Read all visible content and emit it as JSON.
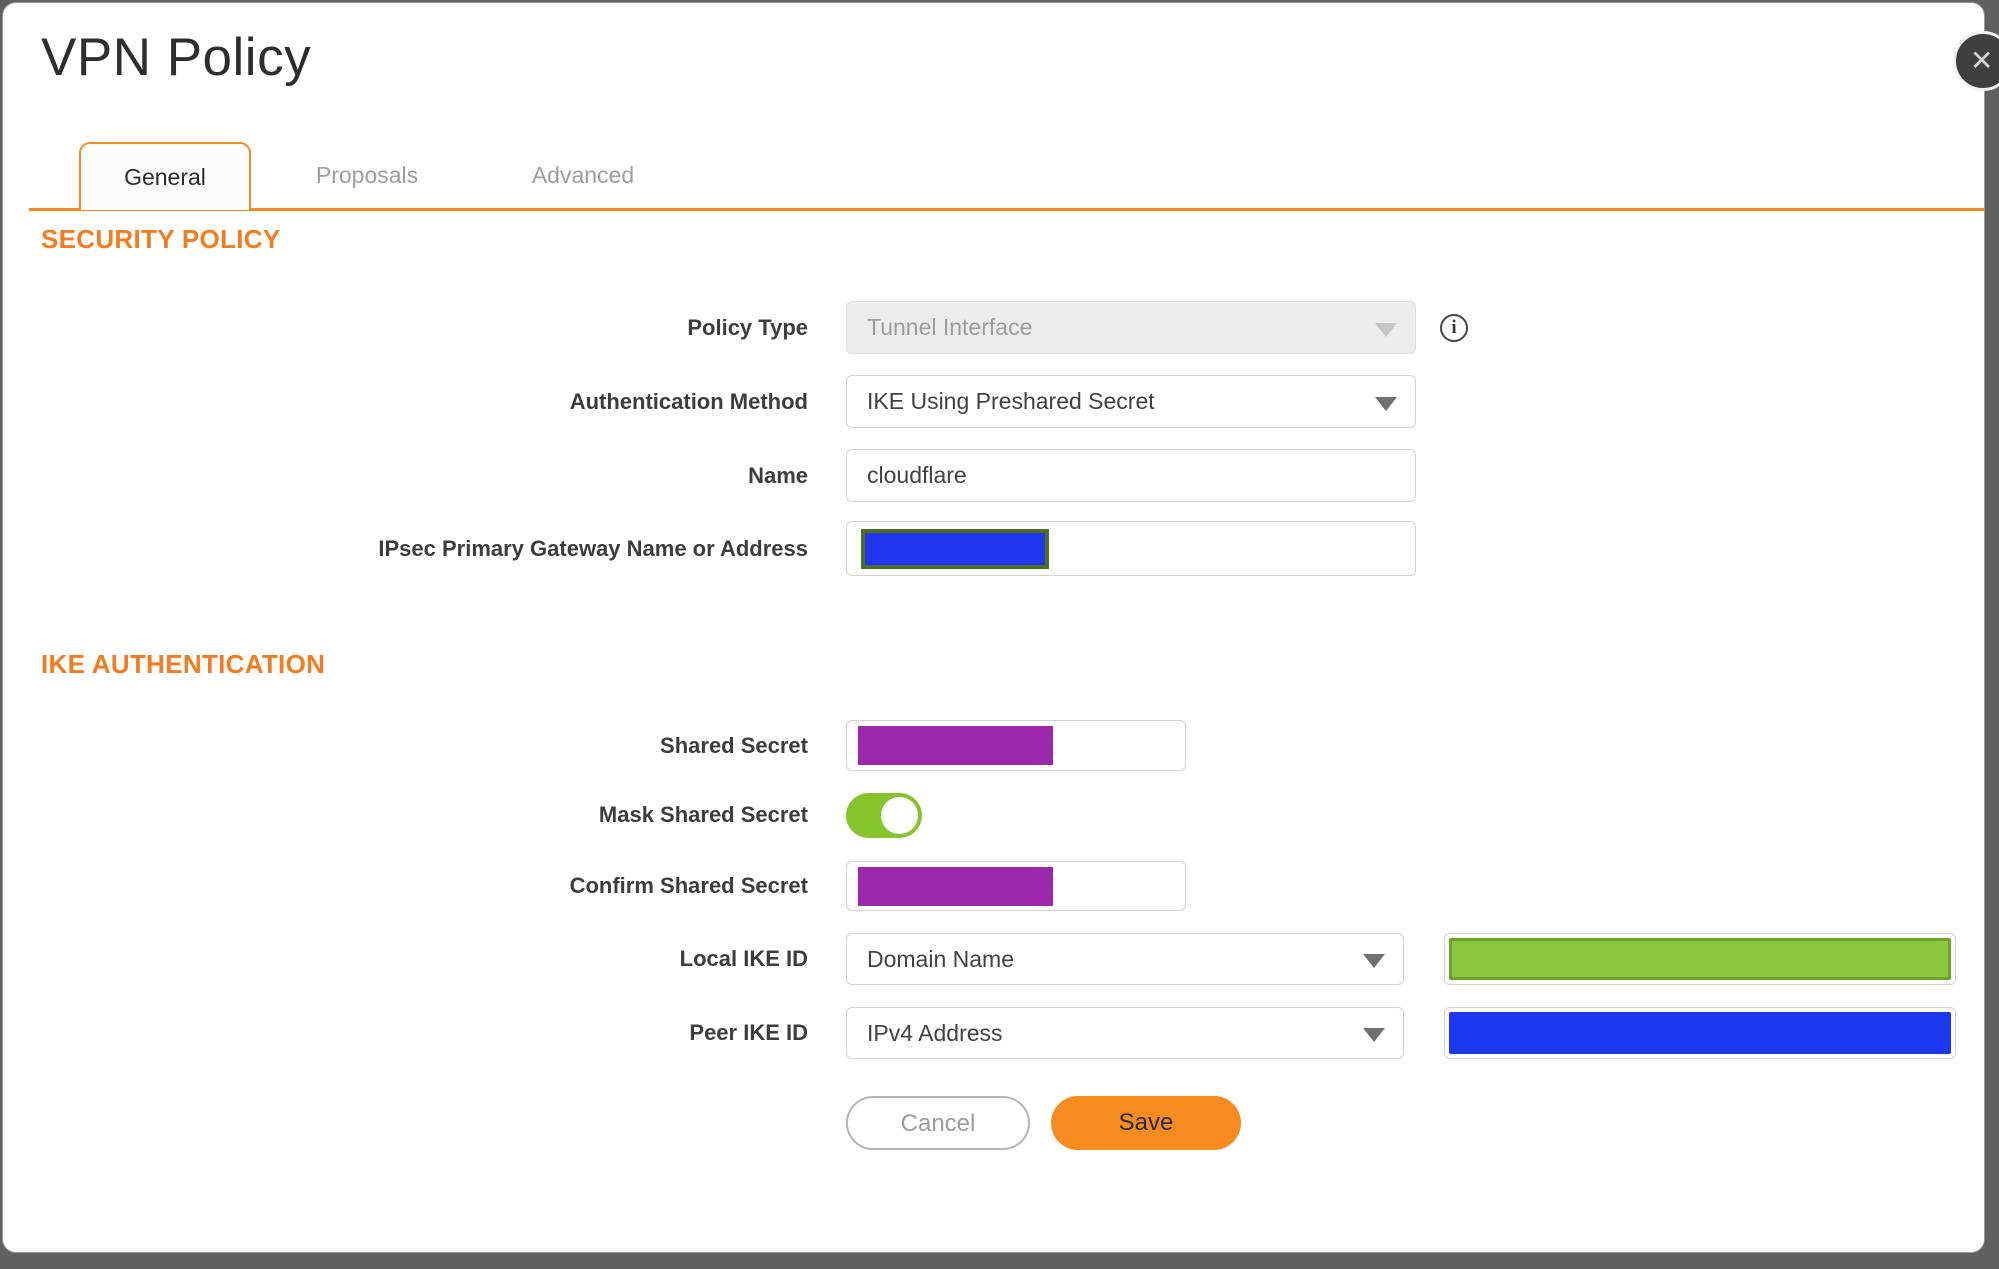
{
  "dialog": {
    "title": "VPN Policy",
    "close_icon": "✕",
    "info_icon": "i"
  },
  "tabs": [
    {
      "label": "General",
      "active": true
    },
    {
      "label": "Proposals",
      "active": false
    },
    {
      "label": "Advanced",
      "active": false
    }
  ],
  "security_policy": {
    "heading": "SECURITY POLICY",
    "policy_type": {
      "label": "Policy Type",
      "value": "Tunnel Interface",
      "disabled": true
    },
    "authentication_method": {
      "label": "Authentication Method",
      "value": "IKE Using Preshared Secret"
    },
    "name": {
      "label": "Name",
      "value": "cloudflare"
    },
    "gateway": {
      "label": "IPsec Primary Gateway Name or Address",
      "value": "",
      "note": "value redacted with blue block"
    }
  },
  "ike_authentication": {
    "heading": "IKE AUTHENTICATION",
    "shared_secret": {
      "label": "Shared Secret",
      "value": "",
      "note": "value redacted with purple block"
    },
    "mask_shared_secret": {
      "label": "Mask Shared Secret",
      "state": "on"
    },
    "confirm_shared_secret": {
      "label": "Confirm Shared Secret",
      "value": "",
      "note": "value redacted with purple block"
    },
    "local_ike_id": {
      "label": "Local IKE ID",
      "value": "Domain Name",
      "note": "id value redacted with green block"
    },
    "peer_ike_id": {
      "label": "Peer IKE ID",
      "value": "IPv4 Address",
      "note": "id value redacted with blue block"
    }
  },
  "actions": {
    "cancel_label": "Cancel",
    "save_label": "Save"
  },
  "colors": {
    "accent_orange": "#F68B1F",
    "heading_orange": "#F47C20",
    "toggle_green": "#86C42C",
    "redact_purple": "#9E28AD",
    "redact_blue": "#1B38F0",
    "redact_green": "#8DC63F",
    "redact_green_border": "#6BA32A",
    "redact_blue_border_olive": "#4C7020",
    "backdrop_gray": "#606060"
  }
}
